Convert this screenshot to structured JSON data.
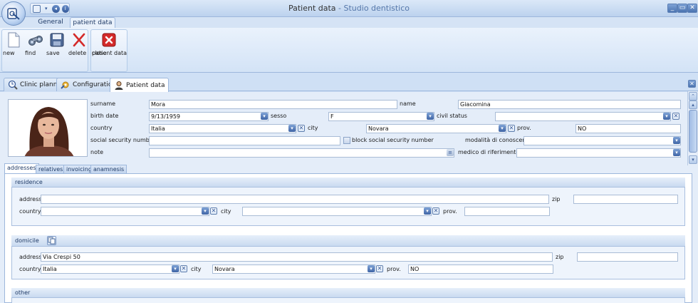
{
  "window": {
    "title": "Patient data",
    "app_name": "Studio dentistico"
  },
  "ribbon": {
    "tabs": [
      "General",
      "patient data"
    ],
    "buttons": {
      "new": "new",
      "find": "find",
      "save": "save",
      "delete": "delete",
      "close_line1": "close",
      "close_line2": "patient data"
    }
  },
  "doc_tabs": [
    "Clinic planner",
    "Configuration",
    "Patient data"
  ],
  "patient": {
    "labels": {
      "surname": "surname",
      "name": "name",
      "birth_date": "birth date",
      "sesso": "sesso",
      "civil_status": "civil status",
      "country": "country",
      "city": "city",
      "prov": "prov.",
      "ssn": "social security number",
      "block_ssn": "block social security number",
      "modalita": "modalità di conoscenza",
      "note": "note",
      "medico": "medico di riferimento"
    },
    "values": {
      "surname": "Mora",
      "name": "Giacomina",
      "birth_date": "9/13/1959",
      "sesso": "F",
      "civil_status": "",
      "country": "Italia",
      "city": "Novara",
      "prov": "NO",
      "ssn": "",
      "modalita": "",
      "note": "",
      "medico": ""
    }
  },
  "sub_tabs": [
    "addresses",
    "relatives",
    "invoicing",
    "anamnesis"
  ],
  "residence": {
    "header": "residence",
    "labels": {
      "address": "address",
      "zip": "zip",
      "country": "country",
      "city": "city",
      "prov": "prov."
    },
    "values": {
      "address": "",
      "zip": "",
      "country": "",
      "city": "",
      "prov": ""
    }
  },
  "domicile": {
    "header": "domicile",
    "labels": {
      "address": "address",
      "zip": "zip",
      "country": "country",
      "city": "city",
      "prov": "prov."
    },
    "values": {
      "address": "Via Crespi 50",
      "zip": "",
      "country": "Italia",
      "city": "Novara",
      "prov": "NO"
    }
  },
  "other": {
    "header": "other"
  },
  "colors": {
    "accent": "#4b73b0",
    "close_red": "#d42a2a"
  }
}
